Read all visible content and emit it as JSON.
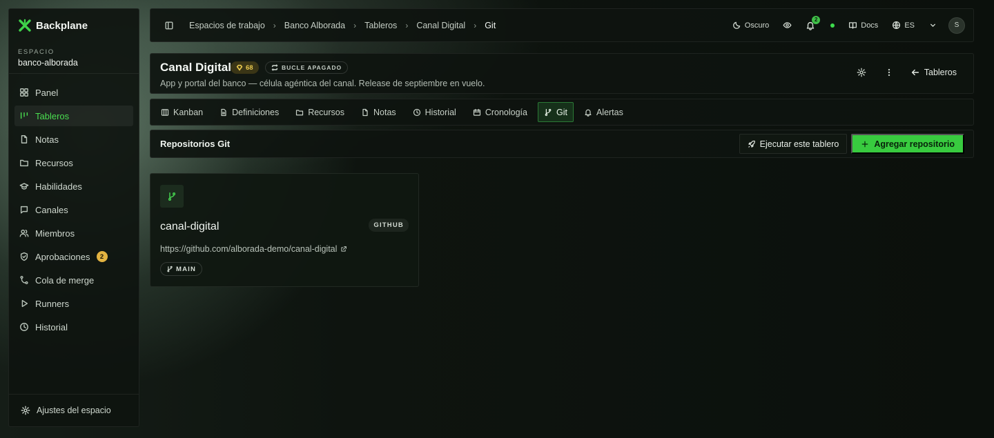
{
  "brand": {
    "name": "Backplane",
    "accent": "#4ade50"
  },
  "workspace": {
    "label": "ESPACIO",
    "name": "banco-alborada"
  },
  "sidebar": {
    "items": [
      {
        "label": "Panel",
        "icon": "grid-icon"
      },
      {
        "label": "Tableros",
        "icon": "kanban-icon",
        "active": true
      },
      {
        "label": "Notas",
        "icon": "file-icon"
      },
      {
        "label": "Recursos",
        "icon": "folder-icon"
      },
      {
        "label": "Habilidades",
        "icon": "graduation-cap-icon"
      },
      {
        "label": "Canales",
        "icon": "chat-icon"
      },
      {
        "label": "Miembros",
        "icon": "users-icon"
      },
      {
        "label": "Aprobaciones",
        "icon": "shield-icon",
        "badge": "2"
      },
      {
        "label": "Cola de merge",
        "icon": "merge-icon"
      },
      {
        "label": "Runners",
        "icon": "play-icon"
      },
      {
        "label": "Historial",
        "icon": "clock-icon"
      }
    ],
    "footer": "Ajustes del espacio"
  },
  "topbar": {
    "breadcrumb": [
      "Espacios de trabajo",
      "Banco Alborada",
      "Tableros",
      "Canal Digital",
      "Git"
    ],
    "theme_label": "Oscuro",
    "notifications_count": "2",
    "docs_label": "Docs",
    "language": "ES",
    "avatar_initial": "S"
  },
  "board": {
    "title": "Canal Digital",
    "score": "68",
    "loop_status": "BUCLE APAGADO",
    "description": "App y portal del banco — célula agéntica del canal. Release de septiembre en vuelo.",
    "back_label": "Tableros"
  },
  "tabs": [
    {
      "label": "Kanban",
      "icon": "columns-icon"
    },
    {
      "label": "Definiciones",
      "icon": "document-icon"
    },
    {
      "label": "Recursos",
      "icon": "folder-icon"
    },
    {
      "label": "Notas",
      "icon": "file-icon"
    },
    {
      "label": "Historial",
      "icon": "clock-icon"
    },
    {
      "label": "Cronología",
      "icon": "calendar-icon"
    },
    {
      "label": "Git",
      "icon": "git-branch-icon",
      "active": true
    },
    {
      "label": "Alertas",
      "icon": "bell-icon"
    }
  ],
  "section": {
    "title": "Repositorios Git",
    "run_label": "Ejecutar este tablero",
    "add_label": "Agregar repositorio"
  },
  "repos": [
    {
      "name": "canal-digital",
      "provider": "GITHUB",
      "url": "https://github.com/alborada-demo/canal-digital",
      "branch": "MAIN"
    }
  ]
}
